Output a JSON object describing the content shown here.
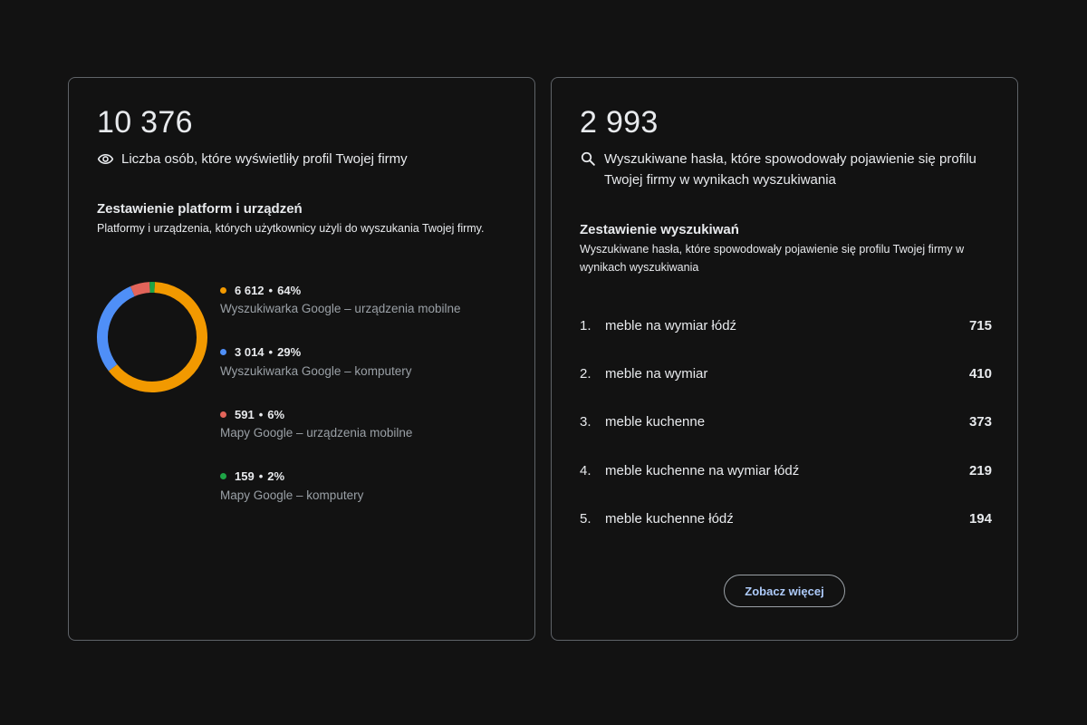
{
  "views_card": {
    "total": "10 376",
    "metric_label": "Liczba osób, które wyświetliły profil Twojej firmy",
    "metric_icon": "eye-icon",
    "section_title": "Zestawienie platform i urządzeń",
    "section_desc": "Platformy i urządzenia, których użytkownicy użyli do wyszukania Twojej firmy.",
    "separator": "•",
    "breakdown": [
      {
        "value": "6 612",
        "percent": "64%",
        "raw": 6612,
        "label": "Wyszukiwarka Google – urządzenia mobilne",
        "color": "#f29900"
      },
      {
        "value": "3 014",
        "percent": "29%",
        "raw": 3014,
        "label": "Wyszukiwarka Google – komputery",
        "color": "#4f8ff7"
      },
      {
        "value": "591",
        "percent": "6%",
        "raw": 591,
        "label": "Mapy Google – urządzenia mobilne",
        "color": "#e2645a"
      },
      {
        "value": "159",
        "percent": "2%",
        "raw": 159,
        "label": "Mapy Google – komputery",
        "color": "#1ea446"
      }
    ]
  },
  "search_card": {
    "total": "2 993",
    "metric_label": "Wyszukiwane hasła, które spowodowały pojawienie się profilu Twojej firmy w wynikach wyszukiwania",
    "metric_icon": "search-icon",
    "section_title": "Zestawienie wyszukiwań",
    "section_desc": "Wyszukiwane hasła, które spowodowały pojawienie się profilu Twojej firmy w wynikach wyszukiwania",
    "terms": [
      {
        "rank": "1.",
        "term": "meble na wymiar łódź",
        "count": "715"
      },
      {
        "rank": "2.",
        "term": "meble na wymiar",
        "count": "410"
      },
      {
        "rank": "3.",
        "term": "meble kuchenne",
        "count": "373"
      },
      {
        "rank": "4.",
        "term": "meble kuchenne na wymiar łódź",
        "count": "219"
      },
      {
        "rank": "5.",
        "term": "meble kuchenne łódź",
        "count": "194"
      }
    ],
    "more_label": "Zobacz więcej"
  }
}
